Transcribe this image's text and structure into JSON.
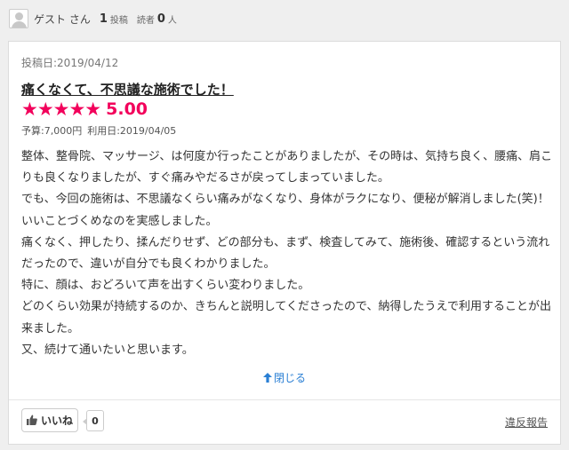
{
  "header": {
    "username": "ゲスト さん",
    "posts_count": "1",
    "posts_label": "投稿",
    "readers_label": "読者",
    "readers_count": "0",
    "readers_unit": "人"
  },
  "review": {
    "post_date": "投稿日:2019/04/12",
    "title": "痛くなくて、不思議な施術でした！",
    "stars": "★★★★★",
    "rating": 5.0,
    "rating_text": "5.00",
    "budget": "予算:7,000円",
    "visit_date": "利用日:2019/04/05",
    "paragraphs": [
      "整体、整骨院、マッサージ、は何度か行ったことがありましたが、その時は、気持ち良く、腰痛、肩こりも良くなりましたが、すぐ痛みやだるさが戻ってしまっていました。",
      "でも、今回の施術は、不思議なくらい痛みがなくなり、身体がラクになり、便秘が解消しました(笑)！いいことづくめなのを実感しました。",
      "痛くなく、押したり、揉んだりせず、どの部分も、まず、検査してみて、施術後、確認するという流れだったので、違いが自分でも良くわかりました。",
      "特に、顔は、おどろいて声を出すくらい変わりました。",
      "どのくらい効果が持続するのか、きちんと説明してくださったので、納得したうえで利用することが出来ました。",
      "又、続けて通いたいと思います。"
    ],
    "close_label": "閉じる"
  },
  "footer": {
    "like_label": "いいね",
    "like_count": "0",
    "report_label": "違反報告"
  },
  "colors": {
    "accent": "#f2005b",
    "link": "#2a7fd4"
  }
}
